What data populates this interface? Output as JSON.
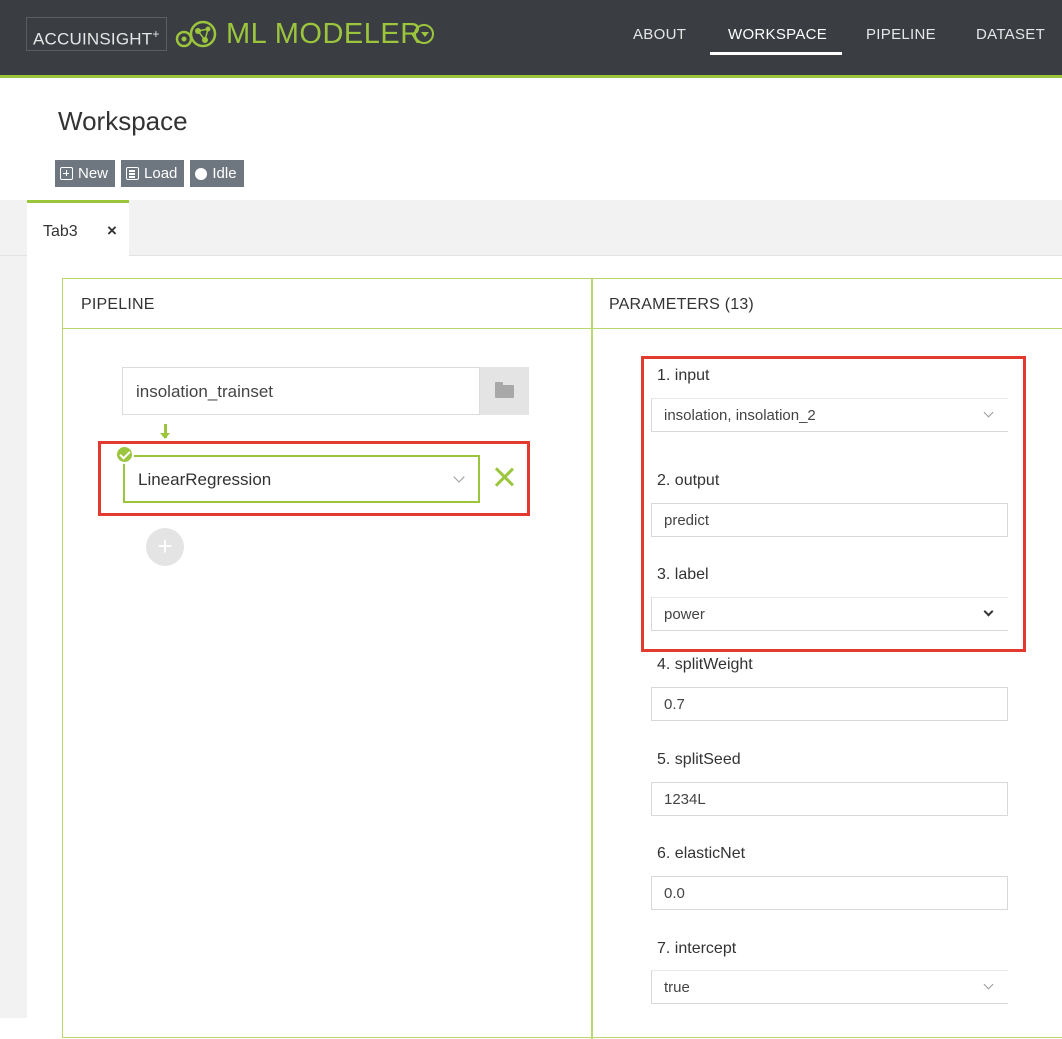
{
  "header": {
    "brand": "ACCUINSIGHT",
    "brand_plus": "+",
    "product": "ML MODELER",
    "nav": [
      {
        "label": "ABOUT"
      },
      {
        "label": "WORKSPACE"
      },
      {
        "label": "PIPELINE"
      },
      {
        "label": "DATASET"
      }
    ],
    "active_nav": "WORKSPACE"
  },
  "page": {
    "title": "Workspace",
    "toolbar": {
      "new_label": "New",
      "load_label": "Load",
      "status_label": "Idle"
    }
  },
  "tabs": [
    {
      "label": "Tab3",
      "close": "×"
    }
  ],
  "pipeline": {
    "header": "PIPELINE",
    "dataset": "insolation_trainset",
    "model": "LinearRegression",
    "add_symbol": "+"
  },
  "parameters": {
    "header": "PARAMETERS (13)",
    "items": [
      {
        "label": "1. input",
        "value": "insolation, insolation_2",
        "type": "select"
      },
      {
        "label": "2. output",
        "value": "predict",
        "type": "text"
      },
      {
        "label": "3. label",
        "value": "power",
        "type": "select"
      },
      {
        "label": "4. splitWeight",
        "value": "0.7",
        "type": "text"
      },
      {
        "label": "5. splitSeed",
        "value": "1234L",
        "type": "text"
      },
      {
        "label": "6. elasticNet",
        "value": "0.0",
        "type": "text"
      },
      {
        "label": "7. intercept",
        "value": "true",
        "type": "select"
      }
    ]
  },
  "colors": {
    "accent": "#9bc53d",
    "topbar": "#3a3d42",
    "highlight": "#e23a2e"
  }
}
